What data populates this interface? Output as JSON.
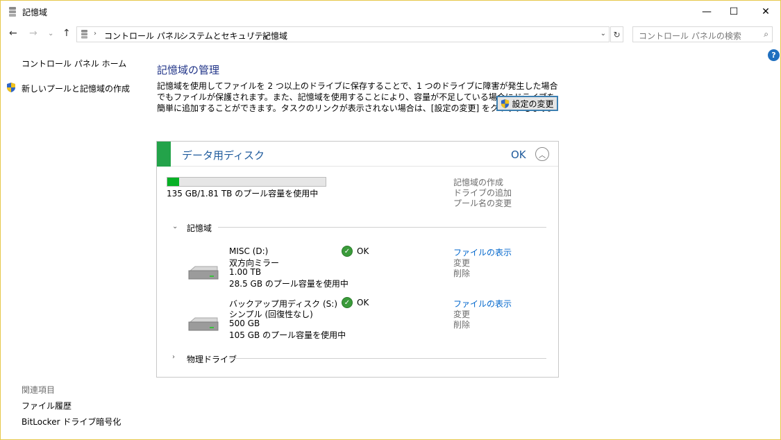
{
  "window": {
    "title": "記憶域",
    "minimize": "—",
    "maximize": "☐",
    "close": "✕"
  },
  "nav": {
    "back": "←",
    "forward": "→",
    "recent": "⌄",
    "up": "↑"
  },
  "address": {
    "crumbs": [
      "コントロール パネル",
      "システムとセキュリティ",
      "記憶域"
    ],
    "separator": "›"
  },
  "search": {
    "placeholder": "コントロール パネルの検索"
  },
  "left_pane": {
    "home_link": "コントロール パネル ホーム",
    "new_pool_link": "新しいプールと記憶域の作成",
    "related_header": "関連項目",
    "related_links": [
      "ファイル履歴",
      "BitLocker ドライブ暗号化"
    ]
  },
  "main": {
    "title": "記憶域の管理",
    "description_lines": [
      "記憶域を使用してファイルを 2 つ以上のドライブに保存することで、1 つのドライブに障害が発生した場合",
      "でもファイルが保護されます。また、記憶域を使用することにより、容量が不足している場合にドライブを",
      "簡単に追加することができます。タスクのリンクが表示されない場合は、[設定の変更] をクリックします。"
    ],
    "settings_button": "設定の変更"
  },
  "pool": {
    "name": "データ用ディスク",
    "status": "OK",
    "usage_fraction": 0.0729,
    "usage_text": "135 GB/1.81 TB のプール容量を使用中",
    "actions": [
      "記憶域の作成",
      "ドライブの追加",
      "プール名の変更"
    ],
    "spaces_section": "記憶域",
    "physical_section": "物理ドライブ",
    "spaces": [
      {
        "lines": [
          "MISC (D:)",
          "双方向ミラー",
          "1.00 TB",
          "28.5 GB のプール容量を使用中"
        ],
        "status": "OK",
        "view_files": "ファイルの表示",
        "change": "変更",
        "delete": "削除"
      },
      {
        "lines": [
          "バックアップ用ディスク (S:)",
          "シンプル (回復性なし)",
          "500 GB",
          "105 GB のプール容量を使用中"
        ],
        "status": "OK",
        "view_files": "ファイルの表示",
        "change": "変更",
        "delete": "削除"
      }
    ]
  },
  "colors": {
    "title_blue": "#1e3287",
    "link_blue": "#0066cc",
    "ok_green": "#06b025",
    "window_border": "#e6c84a"
  }
}
